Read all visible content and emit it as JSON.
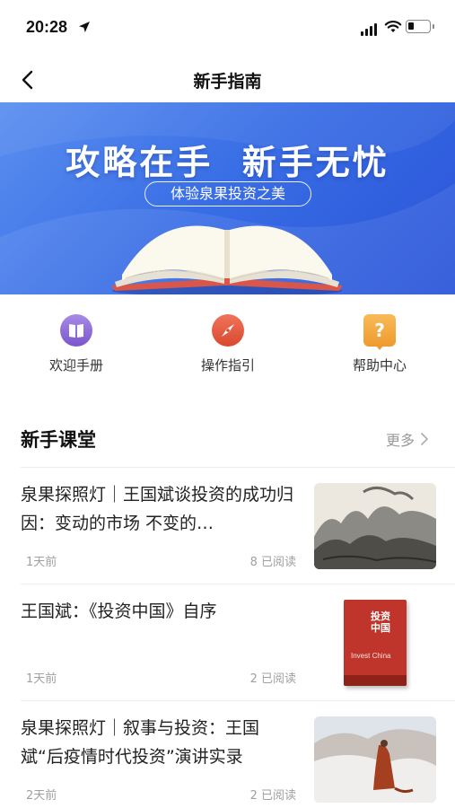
{
  "status_bar": {
    "time": "20:28"
  },
  "nav": {
    "title": "新手指南",
    "back_icon": "chevron-left-icon"
  },
  "banner": {
    "headline": "攻略在手  新手无忧",
    "subtitle": "体验泉果投资之美",
    "colors": {
      "gradient_start": "#5b8ff0",
      "gradient_end": "#2953d8"
    }
  },
  "quick_actions": [
    {
      "label": "欢迎手册",
      "icon": "book-icon",
      "color": "#8a63d2"
    },
    {
      "label": "操作指引",
      "icon": "compass-icon",
      "color": "#e2583e"
    },
    {
      "label": "帮助中心",
      "icon": "question-icon",
      "color": "#f3a53b"
    }
  ],
  "section": {
    "title": "新手课堂",
    "more_label": "更多"
  },
  "articles": [
    {
      "title": "泉果探照灯｜王国斌谈投资的成功归因：变动的市场 不变的…",
      "time": "1天前",
      "reads": "8 已阅读",
      "thumbnail": "landscape-painting"
    },
    {
      "title": "王国斌：《投资中国》自序",
      "time": "1天前",
      "reads": "2 已阅读",
      "thumbnail": "book-cover",
      "cover_title": "投资中国",
      "cover_subtitle": "Invest China"
    },
    {
      "title": "泉果探照灯｜叙事与投资：王国斌“后疫情时代投资”演讲实录",
      "time": "2天前",
      "reads": "2 已阅读",
      "thumbnail": "monk-in-snow"
    }
  ]
}
